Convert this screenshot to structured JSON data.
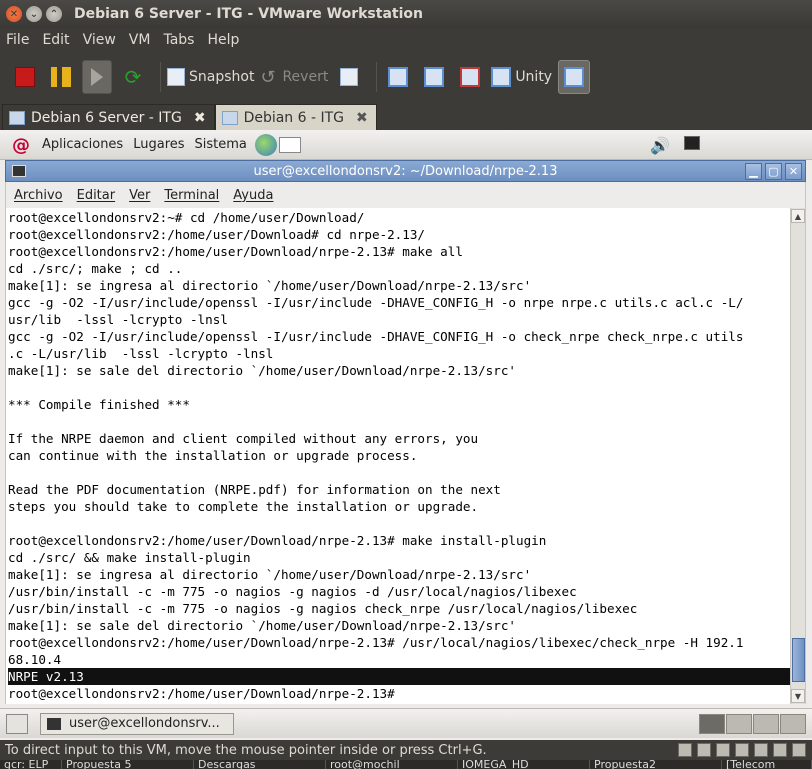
{
  "window": {
    "title": "Debian 6 Server - ITG - VMware Workstation"
  },
  "menubar": [
    "File",
    "Edit",
    "View",
    "VM",
    "Tabs",
    "Help"
  ],
  "toolbar": {
    "snapshot_label": "Snapshot",
    "revert_label": "Revert",
    "unity_label": "Unity"
  },
  "tabs": [
    {
      "label": "Debian 6 Server - ITG",
      "active": true
    },
    {
      "label": "Debian 6 - ITG",
      "active": false
    }
  ],
  "guest_panel": {
    "items": [
      "Aplicaciones",
      "Lugares",
      "Sistema"
    ]
  },
  "terminal": {
    "title": "user@excellondonsrv2: ~/Download/nrpe-2.13",
    "menu": [
      "Archivo",
      "Editar",
      "Ver",
      "Terminal",
      "Ayuda"
    ],
    "lines": [
      "root@excellondonsrv2:~# cd /home/user/Download/",
      "root@excellondonsrv2:/home/user/Download# cd nrpe-2.13/",
      "root@excellondonsrv2:/home/user/Download/nrpe-2.13# make all",
      "cd ./src/; make ; cd ..",
      "make[1]: se ingresa al directorio `/home/user/Download/nrpe-2.13/src'",
      "gcc -g -O2 -I/usr/include/openssl -I/usr/include -DHAVE_CONFIG_H -o nrpe nrpe.c utils.c acl.c -L/",
      "usr/lib  -lssl -lcrypto -lnsl",
      "gcc -g -O2 -I/usr/include/openssl -I/usr/include -DHAVE_CONFIG_H -o check_nrpe check_nrpe.c utils",
      ".c -L/usr/lib  -lssl -lcrypto -lnsl",
      "make[1]: se sale del directorio `/home/user/Download/nrpe-2.13/src'",
      "",
      "*** Compile finished ***",
      "",
      "If the NRPE daemon and client compiled without any errors, you",
      "can continue with the installation or upgrade process.",
      "",
      "Read the PDF documentation (NRPE.pdf) for information on the next",
      "steps you should take to complete the installation or upgrade.",
      "",
      "root@excellondonsrv2:/home/user/Download/nrpe-2.13# make install-plugin",
      "cd ./src/ && make install-plugin",
      "make[1]: se ingresa al directorio `/home/user/Download/nrpe-2.13/src'",
      "/usr/bin/install -c -m 775 -o nagios -g nagios -d /usr/local/nagios/libexec",
      "/usr/bin/install -c -m 775 -o nagios -g nagios check_nrpe /usr/local/nagios/libexec",
      "make[1]: se sale del directorio `/home/user/Download/nrpe-2.13/src'",
      "root@excellondonsrv2:/home/user/Download/nrpe-2.13# /usr/local/nagios/libexec/check_nrpe -H 192.1",
      "68.10.4"
    ],
    "highlighted_line": "NRPE v2.13",
    "prompt_line": "root@excellondonsrv2:/home/user/Download/nrpe-2.13# "
  },
  "guest_taskbar": {
    "window_label": "user@excellondonsrv..."
  },
  "statusbar": {
    "text": "To direct input to this VM, move the mouse pointer inside or press Ctrl+G."
  },
  "host_taskbar": [
    "gcr: ELP",
    "Propuesta 5",
    "Descargas",
    "root@mochil",
    "IOMEGA_HD",
    "Propuesta2",
    "[Telecom"
  ]
}
